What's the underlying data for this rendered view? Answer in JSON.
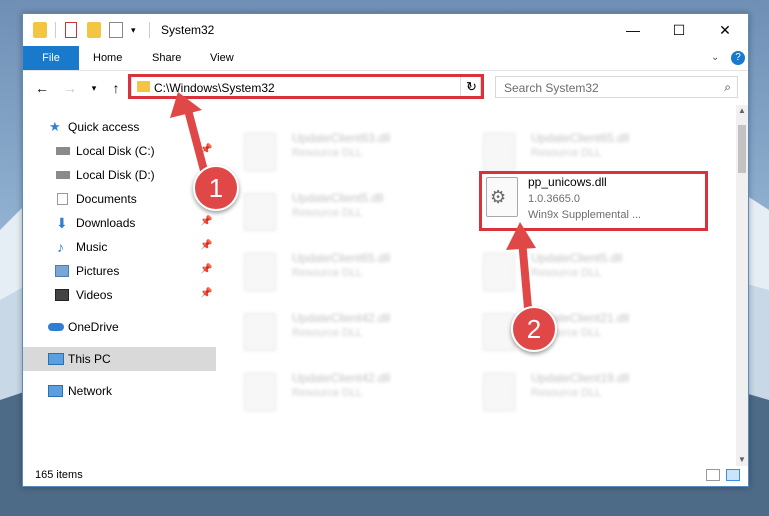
{
  "window": {
    "title": "System32",
    "controls": {
      "minimize": "—",
      "maximize": "☐",
      "close": "✕"
    }
  },
  "ribbon": {
    "file": "File",
    "tabs": [
      "Home",
      "Share",
      "View"
    ]
  },
  "address": {
    "path": "C:\\Windows\\System32",
    "search_placeholder": "Search System32"
  },
  "sidebar": {
    "items": [
      {
        "label": "Quick access",
        "pinned": false
      },
      {
        "label": "Local Disk (C:)",
        "pinned": true
      },
      {
        "label": "Local Disk (D:)",
        "pinned": false
      },
      {
        "label": "Documents",
        "pinned": true
      },
      {
        "label": "Downloads",
        "pinned": true
      },
      {
        "label": "Music",
        "pinned": true
      },
      {
        "label": "Pictures",
        "pinned": true
      },
      {
        "label": "Videos",
        "pinned": true
      },
      {
        "label": "OneDrive",
        "pinned": false
      },
      {
        "label": "This PC",
        "pinned": false,
        "selected": true
      },
      {
        "label": "Network",
        "pinned": false
      }
    ]
  },
  "files": {
    "left": [
      {
        "name": "UpdateClient63.dll",
        "desc": "Resource DLL"
      },
      {
        "name": "UpdateClient5.dll",
        "desc": "Resource DLL"
      },
      {
        "name": "UpdateClient65.dll",
        "desc": "Resource DLL"
      },
      {
        "name": "UpdateClient42.dll",
        "desc": "Resource DLL"
      },
      {
        "name": "UpdateClient42.dll",
        "desc": "Resource DLL"
      }
    ],
    "right": [
      {
        "name": "UpdateClient65.dll",
        "desc": "Resource DLL"
      },
      {
        "name": "UpdateClient5.dll",
        "desc": "Resource DLL"
      },
      {
        "name": "UpdateClient21.dll",
        "desc": "Resource DLL"
      },
      {
        "name": "UpdateClient19.dll",
        "desc": "Resource DLL"
      }
    ],
    "target": {
      "name": "pp_unicows.dll",
      "version": "1.0.3665.0",
      "desc": "Win9x Supplemental ..."
    }
  },
  "status": {
    "items": "165 items"
  },
  "annotations": {
    "step1": "1",
    "step2": "2"
  },
  "colors": {
    "highlight": "#d9323a",
    "accent": "#1979ca"
  }
}
